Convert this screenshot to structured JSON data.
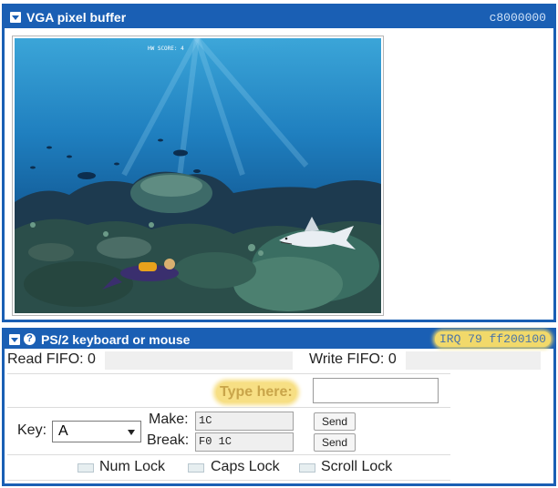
{
  "vga": {
    "title": "VGA pixel buffer",
    "address": "c8000000",
    "screen": {
      "hud_text": "HW SCORE: 4"
    }
  },
  "ps2": {
    "title": "PS/2 keyboard or mouse",
    "help_icon": "?",
    "irq_label": "IRQ 79  ff200100",
    "read_fifo_label": "Read FIFO: 0",
    "write_fifo_label": "Write FIFO: 0",
    "type_here_label": "Type here:",
    "type_input_value": "",
    "key_label": "Key:",
    "key_selected": "A",
    "make_label": "Make:",
    "make_value": "1C",
    "break_label": "Break:",
    "break_value": "F0 1C",
    "send_label": "Send",
    "locks": [
      {
        "label": "Num Lock"
      },
      {
        "label": "Caps Lock"
      },
      {
        "label": "Scroll Lock"
      }
    ]
  },
  "colors": {
    "panel_blue": "#1a5fb4",
    "highlight_yellow": "#f7df84"
  },
  "icons": {
    "collapse": "chevron-down-icon",
    "help": "help-icon"
  }
}
